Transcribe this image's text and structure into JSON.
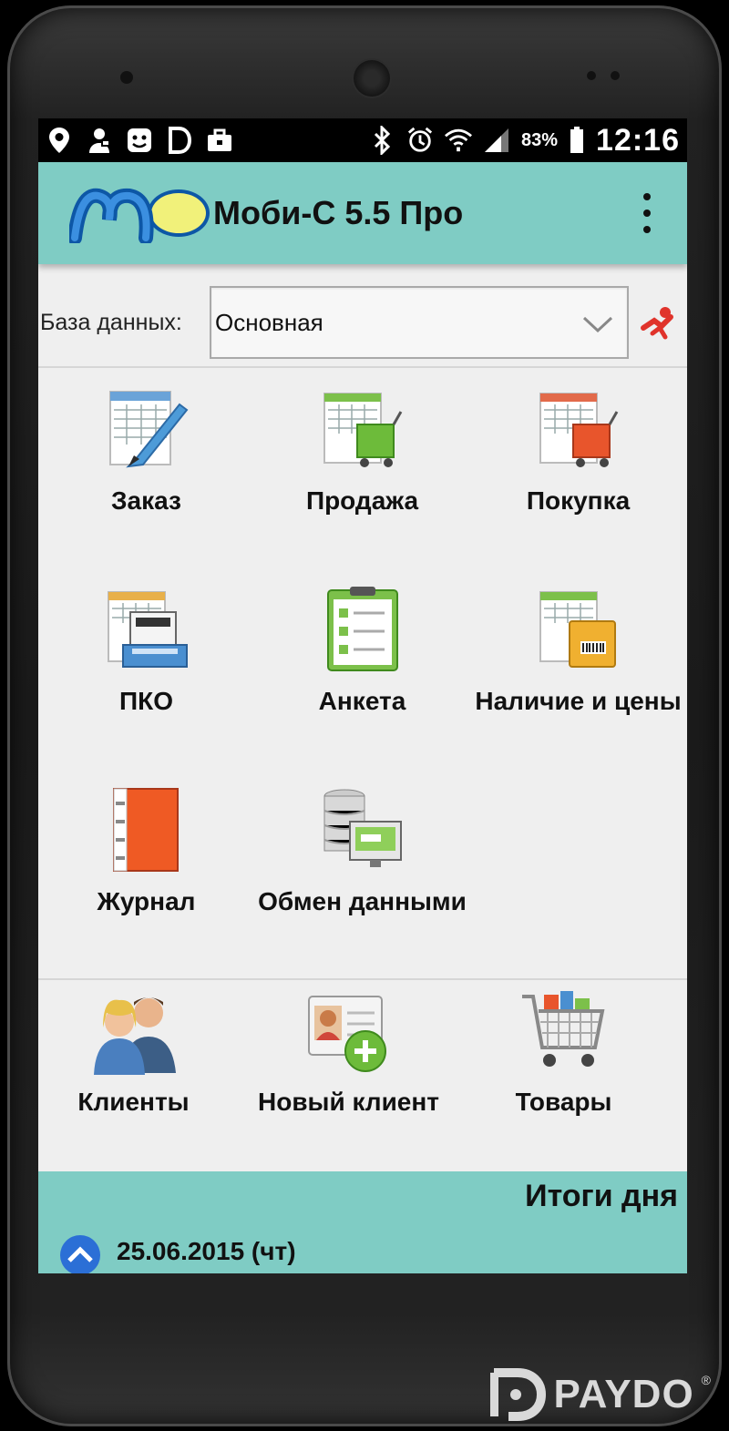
{
  "statusbar": {
    "battery": "83%",
    "time": "12:16",
    "icons": [
      "location-icon",
      "person-icon",
      "face-icon",
      "d-icon",
      "briefcase-icon",
      "bluetooth-icon",
      "alarm-icon",
      "wifi-icon",
      "signal-icon",
      "battery-icon"
    ]
  },
  "appbar": {
    "title": "Моби-С 5.5 Про",
    "logo_icon": "mc-logo-icon",
    "menu_icon": "overflow-menu-icon"
  },
  "database": {
    "label": "База данных:",
    "selected": "Основная"
  },
  "menu_items": [
    {
      "label": "Заказ",
      "icon": "order-icon"
    },
    {
      "label": "Продажа",
      "icon": "sale-icon"
    },
    {
      "label": "Покупка",
      "icon": "purchase-icon"
    },
    {
      "label": "ПКО",
      "icon": "cash-receipt-icon"
    },
    {
      "label": "Анкета",
      "icon": "questionnaire-icon"
    },
    {
      "label": "Наличие и цены",
      "icon": "stock-prices-icon"
    },
    {
      "label": "Журнал",
      "icon": "journal-icon"
    },
    {
      "label": "Обмен данными",
      "icon": "data-exchange-icon"
    }
  ],
  "quick_items": [
    {
      "label": "Клиенты",
      "icon": "clients-icon"
    },
    {
      "label": "Новый клиент",
      "icon": "new-client-icon"
    },
    {
      "label": "Товары",
      "icon": "products-cart-icon"
    }
  ],
  "bottombar": {
    "title": "Итоги дня",
    "date": "25.06.2015 (чт)"
  },
  "watermark": {
    "text": "PAYDO",
    "reg": "®"
  },
  "colors": {
    "accent": "#7fccc4",
    "screen_bg": "#efefef"
  }
}
